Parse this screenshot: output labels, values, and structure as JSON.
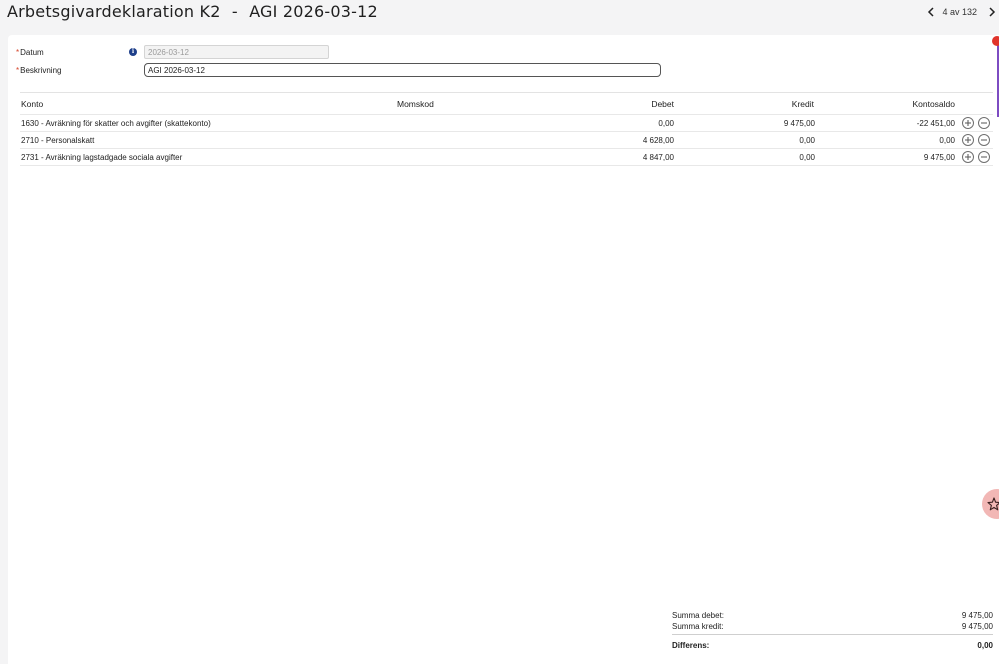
{
  "header": {
    "title": "Arbetsgivardeklaration K2",
    "separator": "-",
    "subtitle": "AGI 2026-03-12",
    "pager": {
      "text": "4 av 132"
    }
  },
  "form": {
    "date": {
      "label": "Datum",
      "required_mark": "*",
      "value": "2026-03-12"
    },
    "description": {
      "label": "Beskrivning",
      "required_mark": "*",
      "value": "AGI 2026-03-12"
    }
  },
  "table": {
    "columns": {
      "konto": "Konto",
      "momskod": "Momskod",
      "debet": "Debet",
      "kredit": "Kredit",
      "saldo": "Kontosaldo"
    },
    "rows": [
      {
        "konto": "1630 - Avräkning för skatter och avgifter (skattekonto)",
        "momskod": "",
        "debet": "0,00",
        "kredit": "9 475,00",
        "saldo": "-22 451,00"
      },
      {
        "konto": "2710 - Personalskatt",
        "momskod": "",
        "debet": "4 628,00",
        "kredit": "0,00",
        "saldo": "0,00"
      },
      {
        "konto": "2731 - Avräkning lagstadgade sociala avgifter",
        "momskod": "",
        "debet": "4 847,00",
        "kredit": "0,00",
        "saldo": "9 475,00"
      }
    ]
  },
  "totals": {
    "debet_label": "Summa debet:",
    "debet_value": "9 475,00",
    "kredit_label": "Summa kredit:",
    "kredit_value": "9 475,00",
    "diff_label": "Differens:",
    "diff_value": "0,00"
  },
  "colors": {
    "accent_purple": "#7d4cc2",
    "badge_red": "#e0342b",
    "info_blue": "#1e3f8a",
    "fab_pink": "#f2b7b5"
  },
  "icons": {
    "prev": "chevron-left-icon",
    "next": "chevron-right-icon",
    "info": "info-icon",
    "add": "plus-circle-icon",
    "remove": "minus-circle-icon",
    "assistant": "sparkle-star-icon"
  }
}
